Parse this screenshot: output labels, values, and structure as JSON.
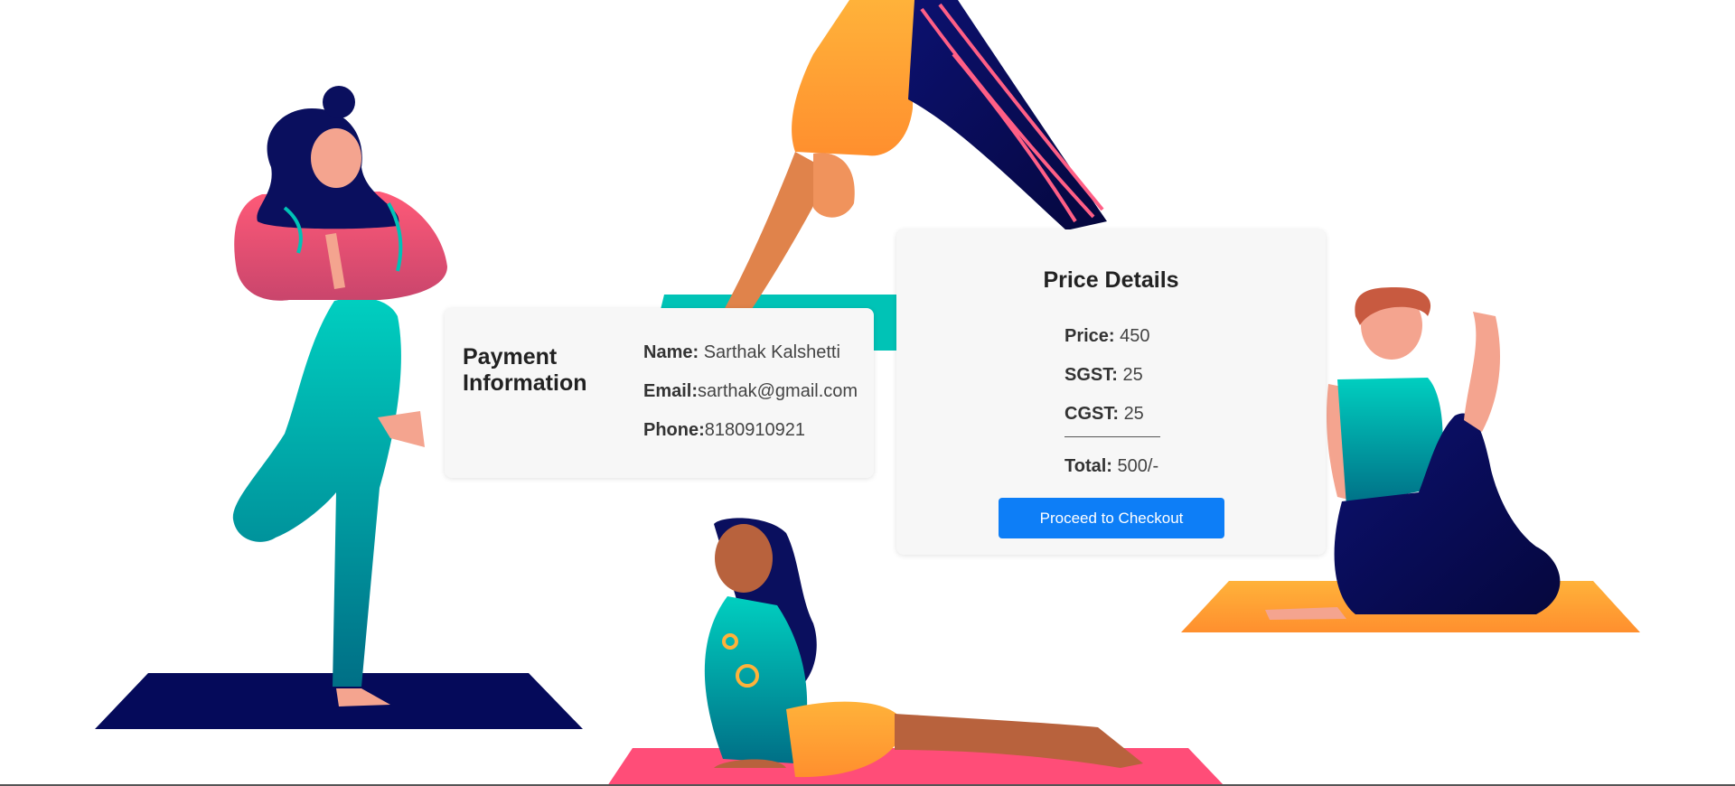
{
  "payment": {
    "title": "Payment Information",
    "name_label": "Name:",
    "name_value": "Sarthak Kalshetti",
    "email_label": "Email:",
    "email_value": "sarthak@gmail.com",
    "phone_label": "Phone:",
    "phone_value": "8180910921"
  },
  "price": {
    "title": "Price Details",
    "price_label": "Price:",
    "price_value": "450",
    "sgst_label": "SGST:",
    "sgst_value": "25",
    "cgst_label": "CGST:",
    "cgst_value": "25",
    "total_label": "Total:",
    "total_value": "500/-",
    "checkout_label": "Proceed to Checkout"
  },
  "colors": {
    "accent": "#0d7ef7",
    "teal": "#00c3b6",
    "navy": "#050a5a",
    "orange": "#ffa93a",
    "pink": "#ff4d78"
  }
}
